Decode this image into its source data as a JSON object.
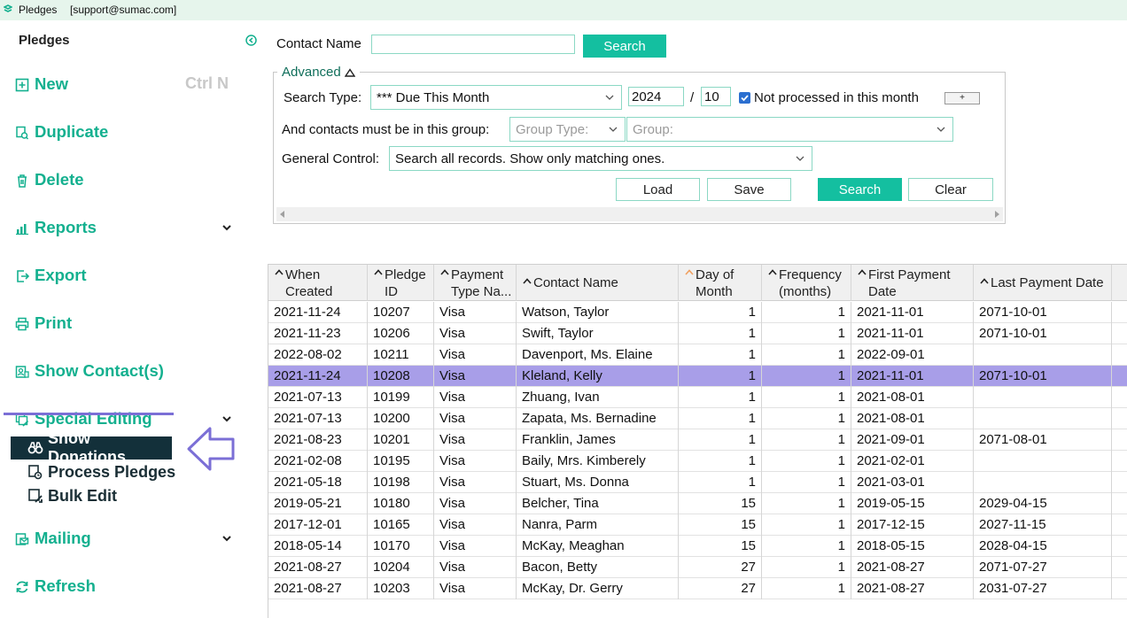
{
  "window": {
    "title": "Pledges",
    "user": "[support@sumac.com]"
  },
  "sidebar": {
    "title": "Pledges",
    "items": [
      {
        "id": "new",
        "label": "New",
        "shortcut": "Ctrl N",
        "icon": "plus-square-icon"
      },
      {
        "id": "duplicate",
        "label": "Duplicate",
        "icon": "duplicate-icon"
      },
      {
        "id": "delete",
        "label": "Delete",
        "icon": "trash-icon"
      },
      {
        "id": "reports",
        "label": "Reports",
        "icon": "bar-chart-icon",
        "expandable": true
      },
      {
        "id": "export",
        "label": "Export",
        "icon": "export-icon"
      },
      {
        "id": "print",
        "label": "Print",
        "icon": "printer-icon"
      },
      {
        "id": "show-contacts",
        "label": "Show Contact(s)",
        "icon": "contacts-icon"
      },
      {
        "id": "special-editing",
        "label": "Special Editing",
        "icon": "edit-stack-icon",
        "expandable": true
      },
      {
        "id": "mailing",
        "label": "Mailing",
        "icon": "mailing-icon",
        "expandable": true
      },
      {
        "id": "refresh",
        "label": "Refresh",
        "icon": "refresh-icon"
      }
    ],
    "special_editing_sub": [
      {
        "label": "Show Donations",
        "icon": "binoculars-icon",
        "active": true
      },
      {
        "label": "Process Pledges",
        "icon": "process-icon"
      },
      {
        "label": "Bulk Edit",
        "icon": "bulk-edit-icon"
      }
    ]
  },
  "search": {
    "contact_label": "Contact Name",
    "contact_value": "",
    "search_button": "Search",
    "advanced_label": "Advanced",
    "search_type_label": "Search Type:",
    "search_type_value": "*** Due This Month",
    "year": "2024",
    "slash": "/",
    "month": "10",
    "not_processed_label": "Not processed in this month",
    "not_processed_checked": true,
    "plus_label": "+",
    "group_label": "And contacts must be in this group:",
    "group_type_placeholder": "Group Type:",
    "group_placeholder": "Group:",
    "general_control_label": "General Control:",
    "general_control_value": "Search all records. Show only matching ones.",
    "load_button": "Load",
    "save_button": "Save",
    "search_button2": "Search",
    "clear_button": "Clear"
  },
  "grid": {
    "columns": [
      {
        "line1": "When",
        "line2": "Created"
      },
      {
        "line1": "Pledge",
        "line2": "ID"
      },
      {
        "line1": "Payment",
        "line2": "Type Na..."
      },
      {
        "line1": "Contact Name",
        "line2": ""
      },
      {
        "line1": "Day of",
        "line2": "Month",
        "sort_active": true
      },
      {
        "line1": "Frequency",
        "line2": "(months)"
      },
      {
        "line1": "First Payment",
        "line2": "Date"
      },
      {
        "line1": "Last Payment Date",
        "line2": ""
      }
    ],
    "rows": [
      [
        "2021-11-24",
        "10207",
        "Visa",
        "Watson, Taylor",
        "1",
        "1",
        "2021-11-01",
        "2071-10-01"
      ],
      [
        "2021-11-23",
        "10206",
        "Visa",
        "Swift, Taylor",
        "1",
        "1",
        "2021-11-01",
        "2071-10-01"
      ],
      [
        "2022-08-02",
        "10211",
        "Visa",
        "Davenport, Ms. Elaine",
        "1",
        "1",
        "2022-09-01",
        ""
      ],
      [
        "2021-11-24",
        "10208",
        "Visa",
        "Kleland, Kelly",
        "1",
        "1",
        "2021-11-01",
        "2071-10-01"
      ],
      [
        "2021-07-13",
        "10199",
        "Visa",
        "Zhuang, Ivan",
        "1",
        "1",
        "2021-08-01",
        ""
      ],
      [
        "2021-07-13",
        "10200",
        "Visa",
        "Zapata, Ms. Bernadine",
        "1",
        "1",
        "2021-08-01",
        ""
      ],
      [
        "2021-08-23",
        "10201",
        "Visa",
        "Franklin, James",
        "1",
        "1",
        "2021-09-01",
        "2071-08-01"
      ],
      [
        "2021-02-08",
        "10195",
        "Visa",
        "Baily, Mrs. Kimberely",
        "1",
        "1",
        "2021-02-01",
        ""
      ],
      [
        "2021-05-18",
        "10198",
        "Visa",
        "Stuart, Ms. Donna",
        "1",
        "1",
        "2021-03-01",
        ""
      ],
      [
        "2019-05-21",
        "10180",
        "Visa",
        "Belcher, Tina",
        "15",
        "1",
        "2019-05-15",
        "2029-04-15"
      ],
      [
        "2017-12-01",
        "10165",
        "Visa",
        "Nanra, Parm",
        "15",
        "1",
        "2017-12-15",
        "2027-11-15"
      ],
      [
        "2018-05-14",
        "10170",
        "Visa",
        "McKay, Meaghan",
        "15",
        "1",
        "2018-05-15",
        "2028-04-15"
      ],
      [
        "2021-08-27",
        "10204",
        "Visa",
        "Bacon, Betty",
        "27",
        "1",
        "2021-08-27",
        "2071-07-27"
      ],
      [
        "2021-08-27",
        "10203",
        "Visa",
        "McKay, Dr. Gerry",
        "27",
        "1",
        "2021-08-27",
        "2031-07-27"
      ]
    ],
    "selected_row": 3
  },
  "colors": {
    "accent": "#14bfa0",
    "sidebar_text": "#14b08f",
    "selected_row": "#a89ee8",
    "annotation": "#7b6fd6"
  }
}
